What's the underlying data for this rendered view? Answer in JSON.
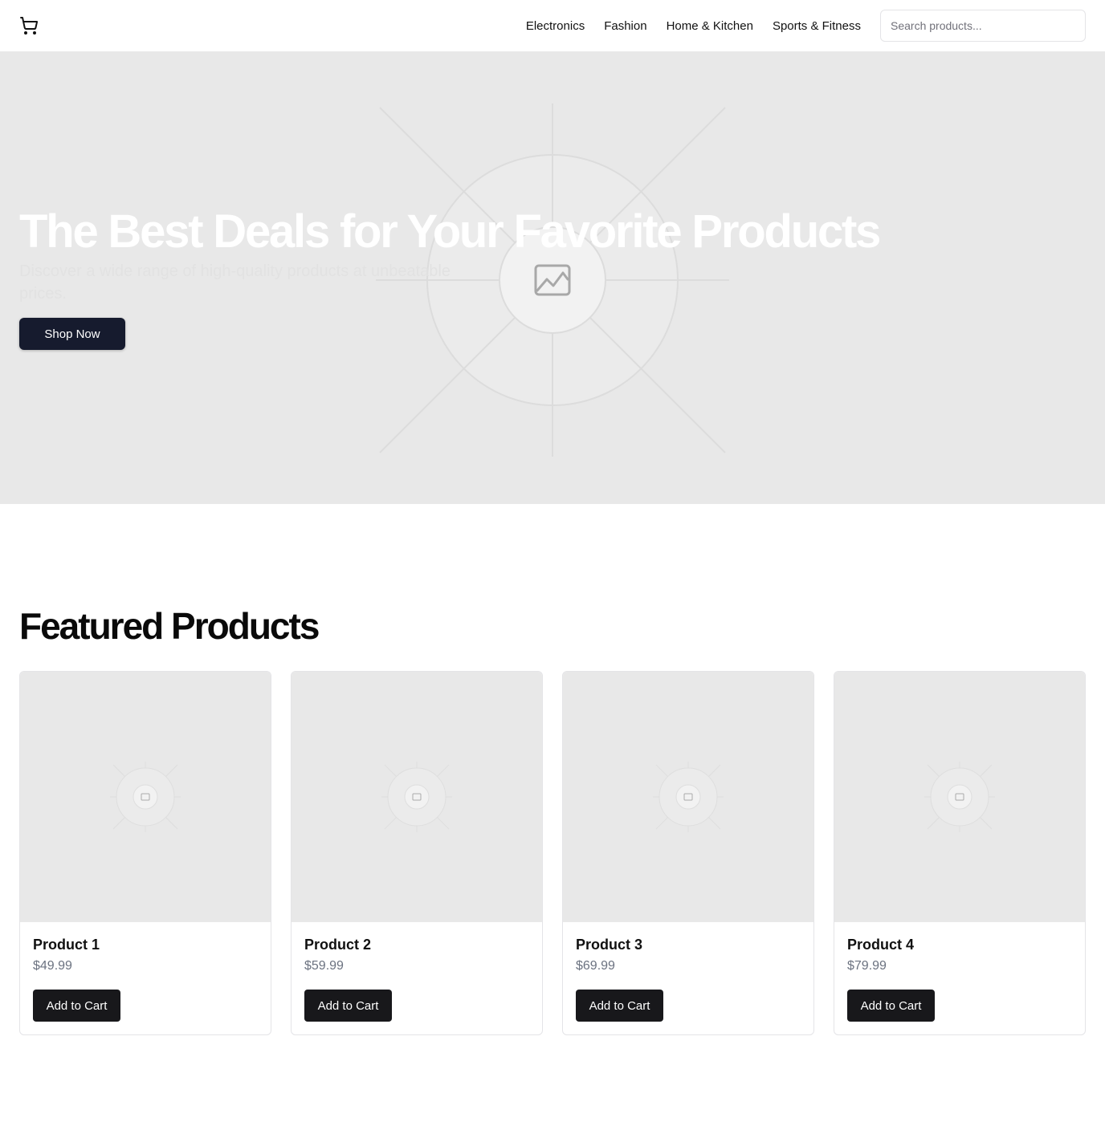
{
  "header": {
    "cart_icon": "shopping-cart-icon",
    "nav": [
      "Electronics",
      "Fashion",
      "Home & Kitchen",
      "Sports & Fitness"
    ],
    "search_placeholder": "Search products..."
  },
  "hero": {
    "title": "The Best Deals for Your Favorite Products",
    "subtitle": "Discover a wide range of high-quality products at unbeatable prices.",
    "cta": "Shop Now",
    "image_icon": "image-placeholder-icon"
  },
  "featured": {
    "title": "Featured Products",
    "products": [
      {
        "name": "Product 1",
        "price": "$49.99",
        "cta": "Add to Cart"
      },
      {
        "name": "Product 2",
        "price": "$59.99",
        "cta": "Add to Cart"
      },
      {
        "name": "Product 3",
        "price": "$69.99",
        "cta": "Add to Cart"
      },
      {
        "name": "Product 4",
        "price": "$79.99",
        "cta": "Add to Cart"
      }
    ]
  },
  "colors": {
    "primary_button": "#161b2e",
    "card_button": "#18181b",
    "placeholder_bg": "#e8e8e8",
    "price_text": "#6b7280"
  }
}
